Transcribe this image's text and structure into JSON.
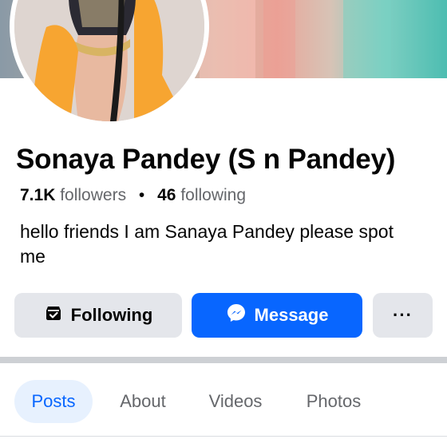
{
  "profile": {
    "name": "Sonaya Pandey (S n Pandey)",
    "followers_count": "7.1K",
    "followers_label": "followers",
    "separator": "•",
    "following_count": "46",
    "following_label": "following",
    "bio": "hello friends I am Sanaya Pandey please spot me"
  },
  "actions": {
    "following_label": "Following",
    "following_icon": "inbox-check-icon",
    "message_label": "Message",
    "message_icon": "messenger-icon",
    "more_label": "···"
  },
  "tabs": [
    {
      "label": "Posts",
      "active": true
    },
    {
      "label": "About",
      "active": false
    },
    {
      "label": "Videos",
      "active": false
    },
    {
      "label": "Photos",
      "active": false
    }
  ],
  "colors": {
    "accent": "#0866ff",
    "active_tab_bg": "#e7f1fe",
    "button_gray": "#e4e6eb",
    "secondary_text": "#65676b"
  }
}
